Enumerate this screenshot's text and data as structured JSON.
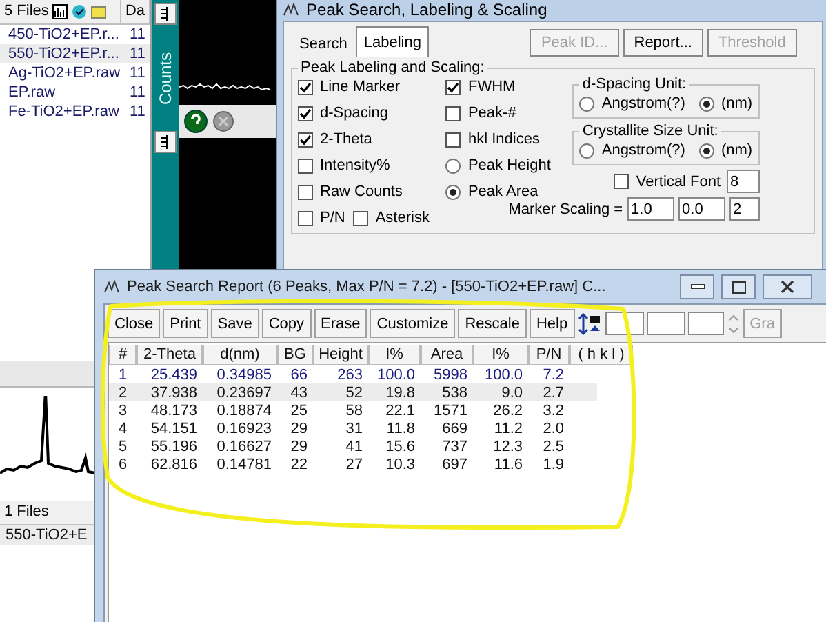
{
  "file_panel": {
    "header": "5 Files",
    "column_2": "Da",
    "files": [
      {
        "name": "450-TiO2+EP.r...",
        "column_2": "11",
        "selected": false
      },
      {
        "name": "550-TiO2+EP.r...",
        "column_2": "11",
        "selected": true
      },
      {
        "name": "Ag-TiO2+EP.raw",
        "column_2": "11",
        "selected": false
      },
      {
        "name": "EP.raw",
        "column_2": "11",
        "selected": false
      },
      {
        "name": "Fe-TiO2+EP.raw",
        "column_2": "11",
        "selected": false
      }
    ]
  },
  "plot_strip": {
    "axis_label": "Counts"
  },
  "peak_dialog": {
    "title": "Peak Search, Labeling & Scaling",
    "tabs": [
      {
        "label": "Search",
        "selected": false
      },
      {
        "label": "Labeling",
        "selected": true
      }
    ],
    "buttons": [
      {
        "label": "Peak ID...",
        "disabled": true
      },
      {
        "label": "Report...",
        "disabled": false
      },
      {
        "label": "Threshold",
        "disabled": true
      }
    ],
    "group_title": "Peak Labeling and Scaling:",
    "column_1": [
      {
        "kind": "checkbox",
        "label": "Line Marker",
        "checked": true
      },
      {
        "kind": "checkbox",
        "label": "d-Spacing",
        "checked": true
      },
      {
        "kind": "checkbox",
        "label": "2-Theta",
        "checked": true
      },
      {
        "kind": "checkbox",
        "label": "Intensity%",
        "checked": false
      },
      {
        "kind": "checkbox",
        "label": "Raw Counts",
        "checked": false
      }
    ],
    "column_2": [
      {
        "kind": "checkbox",
        "label": "FWHM",
        "checked": true
      },
      {
        "kind": "checkbox",
        "label": "Peak-#",
        "checked": false
      },
      {
        "kind": "checkbox",
        "label": "hkl Indices",
        "checked": false
      },
      {
        "kind": "radio",
        "label": "Peak Height",
        "checked": false
      },
      {
        "kind": "radio",
        "label": "Peak Area",
        "checked": true
      }
    ],
    "bottom_row": [
      {
        "kind": "checkbox",
        "label": "P/N",
        "checked": false
      },
      {
        "kind": "checkbox",
        "label": "Asterisk",
        "checked": false
      }
    ],
    "d_spacing_unit": {
      "title": "d-Spacing Unit:",
      "options": [
        {
          "label": "Angstrom(?)",
          "selected": false
        },
        {
          "label": "(nm)",
          "selected": true
        }
      ]
    },
    "crystallite_size_unit": {
      "title": "Crystallite Size Unit:",
      "options": [
        {
          "label": "Angstrom(?)",
          "selected": false
        },
        {
          "label": "(nm)",
          "selected": true
        }
      ]
    },
    "vertical_font": {
      "label": "Vertical Font",
      "checked": false,
      "value": "8"
    },
    "marker_scaling": {
      "label": "Marker Scaling =",
      "values": [
        "1.0",
        "0.0",
        "2"
      ]
    }
  },
  "report": {
    "title": "Peak Search Report (6 Peaks, Max P/N = 7.2) - [550-TiO2+EP.raw] C...",
    "buttons": [
      "Close",
      "Print",
      "Save",
      "Copy",
      "Erase",
      "Customize",
      "Rescale",
      "Help"
    ],
    "graph_button": {
      "label": "Gra",
      "disabled": true
    },
    "columns": [
      "#",
      "2-Theta",
      "d(nm)",
      "BG",
      "Height",
      "I%",
      "Area",
      "I%",
      "P/N",
      "( h k l )"
    ],
    "rows": [
      {
        "cells": [
          "1",
          "25.439",
          "0.34985",
          "66",
          "263",
          "100.0",
          "5998",
          "100.0",
          "7.2"
        ],
        "highlighted": true,
        "selected": false
      },
      {
        "cells": [
          "2",
          "37.938",
          "0.23697",
          "43",
          "52",
          "19.8",
          "538",
          "9.0",
          "2.7"
        ],
        "highlighted": false,
        "selected": true
      },
      {
        "cells": [
          "3",
          "48.173",
          "0.18874",
          "25",
          "58",
          "22.1",
          "1571",
          "26.2",
          "3.2"
        ],
        "highlighted": false,
        "selected": false
      },
      {
        "cells": [
          "4",
          "54.151",
          "0.16923",
          "29",
          "31",
          "11.8",
          "669",
          "11.2",
          "2.0"
        ],
        "highlighted": false,
        "selected": false
      },
      {
        "cells": [
          "5",
          "55.196",
          "0.16627",
          "29",
          "41",
          "15.6",
          "737",
          "12.3",
          "2.5"
        ],
        "highlighted": false,
        "selected": false
      },
      {
        "cells": [
          "6",
          "62.816",
          "0.14781",
          "22",
          "27",
          "10.3",
          "697",
          "11.6",
          "1.9"
        ],
        "highlighted": false,
        "selected": false
      }
    ]
  },
  "bottom_panel": {
    "header": "1 Files",
    "files": [
      {
        "name": "550-TiO2+E"
      }
    ]
  }
}
